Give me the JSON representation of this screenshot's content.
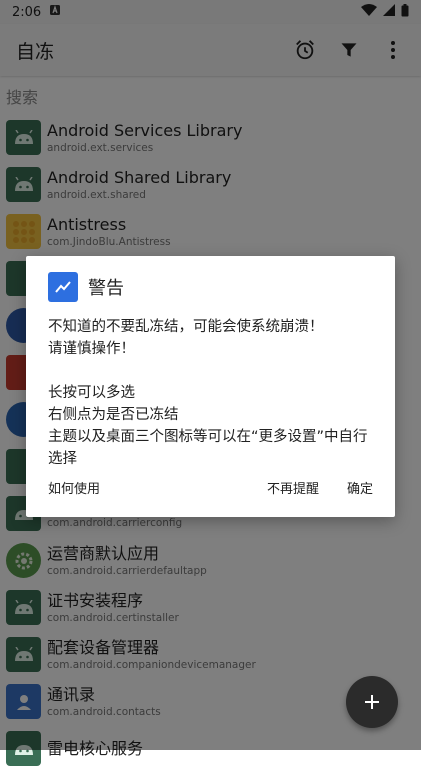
{
  "status_bar": {
    "time": "2:06"
  },
  "app_bar": {
    "title": "自冻"
  },
  "search": {
    "placeholder": "搜索"
  },
  "apps": [
    {
      "name": "Android Services Library",
      "package": "android.ext.services",
      "icon": "android-robot-icon"
    },
    {
      "name": "Android Shared Library",
      "package": "android.ext.shared",
      "icon": "android-robot-icon"
    },
    {
      "name": "Antistress",
      "package": "com.JindoBlu.Antistress",
      "icon": "antistress-app-icon"
    },
    {
      "name": "运营商默认应用",
      "package": "com.android.carrierdefaultapp",
      "icon": "gear-icon"
    },
    {
      "name": "证书安装程序",
      "package": "com.android.certinstaller",
      "icon": "android-robot-icon"
    },
    {
      "name": "配套设备管理器",
      "package": "com.android.companiondevicemanager",
      "icon": "android-robot-icon"
    },
    {
      "name": "通讯录",
      "package": "com.android.contacts",
      "icon": "contacts-icon"
    },
    {
      "name": "雷电核心服务",
      "package": "",
      "icon": "android-robot-icon"
    }
  ],
  "partial_row": {
    "package": "com.android.carrierconfig"
  },
  "dialog": {
    "title": "警告",
    "message": "不知道的不要乱冻结，可能会使系统崩溃！\n请谨慎操作！\n\n长按可以多选\n右侧点为是否已冻结\n主题以及桌面三个图标等可以在“更多设置”中自行选择",
    "actions": {
      "how_to_use": "如何使用",
      "dont_remind": "不再提醒",
      "confirm": "确定"
    }
  },
  "colors": {
    "scrim": "#000000",
    "dialog_icon": "#2d6fe0",
    "android_icon": "#3a6e55"
  }
}
